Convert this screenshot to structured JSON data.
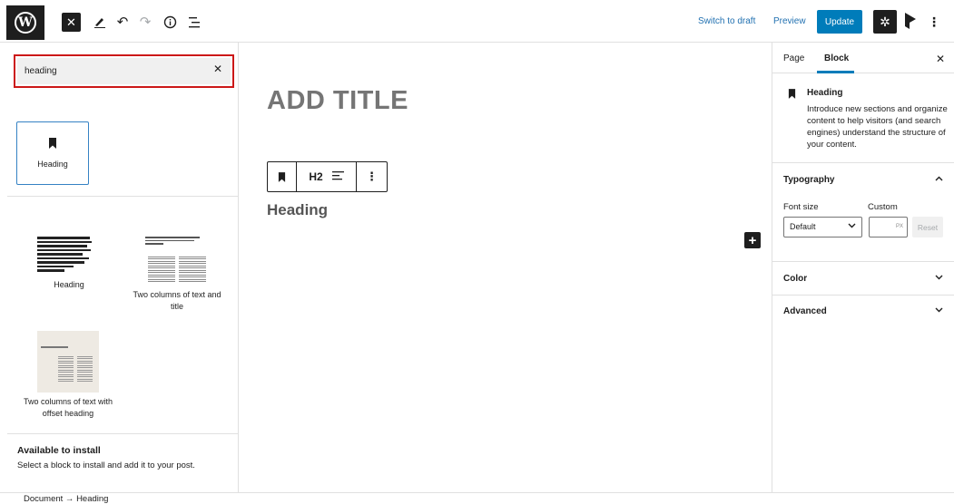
{
  "topbar": {
    "switch_to_draft": "Switch to draft",
    "preview": "Preview",
    "update": "Update",
    "icons": [
      "wordpress-logo",
      "close-icon",
      "pencil-icon",
      "undo-icon",
      "redo-icon",
      "info-icon",
      "list-view-icon",
      "gear-icon",
      "plugin-icon",
      "more-vertical-icon"
    ]
  },
  "inserter": {
    "search_value": "heading",
    "blocks": [
      {
        "label": "Heading",
        "icon": "bookmark-icon"
      }
    ],
    "patterns": [
      {
        "label": "Heading"
      },
      {
        "label": "Two columns of text and title"
      },
      {
        "label": "Two columns of text with offset heading"
      }
    ],
    "available_title": "Available to install",
    "available_desc": "Select a block to install and add it to your post."
  },
  "canvas": {
    "title_placeholder": "ADD TITLE",
    "toolbar_level": "H2",
    "heading_text": "Heading"
  },
  "sidebar": {
    "tabs": [
      "Page",
      "Block"
    ],
    "active_tab": "Block",
    "block_name": "Heading",
    "block_desc": "Introduce new sections and organize content to help visitors (and search engines) understand the structure of your content.",
    "typography": "Typography",
    "font_size_label": "Font size",
    "custom_label": "Custom",
    "font_size_value": "Default",
    "custom_unit": "PX",
    "reset": "Reset",
    "color": "Color",
    "advanced": "Advanced"
  },
  "footer": {
    "breadcrumb": "Document → Heading"
  },
  "colors": {
    "accent": "#007cba",
    "link": "#2271b1",
    "dark": "#1e1e1e",
    "highlight_border": "#cc1818"
  }
}
